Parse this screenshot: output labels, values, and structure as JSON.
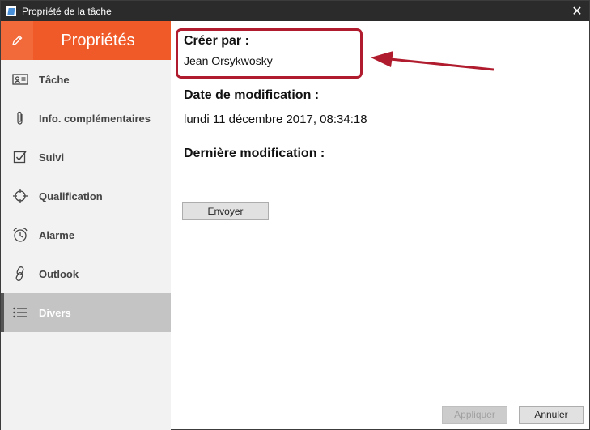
{
  "window": {
    "title": "Propriété de la tâche",
    "close_glyph": "✕"
  },
  "sidebar": {
    "header": {
      "title": "Propriétés",
      "icon": "pencil-icon"
    },
    "items": [
      {
        "label": "Tâche",
        "icon": "contact-card-icon"
      },
      {
        "label": "Info. complémentaires",
        "icon": "paperclip-icon"
      },
      {
        "label": "Suivi",
        "icon": "checkbox-icon"
      },
      {
        "label": "Qualification",
        "icon": "crosshair-icon"
      },
      {
        "label": "Alarme",
        "icon": "alarm-clock-icon"
      },
      {
        "label": "Outlook",
        "icon": "link-icon"
      },
      {
        "label": "Divers",
        "icon": "list-icon",
        "active": true
      }
    ]
  },
  "main": {
    "created_by": {
      "label": "Créer par :",
      "value": "Jean Orsykwosky"
    },
    "modified_date": {
      "label": "Date de modification :",
      "value": "lundi 11 décembre 2017, 08:34:18"
    },
    "last_modification": {
      "label": "Dernière modification :",
      "value": ""
    },
    "send_button": "Envoyer"
  },
  "footer": {
    "apply_button": "Appliquer",
    "cancel_button": "Annuler"
  },
  "colors": {
    "accent": "#f05a28",
    "highlight": "#b01c2e",
    "titlebar": "#2b2b2b",
    "active_item": "#c4c4c4"
  }
}
